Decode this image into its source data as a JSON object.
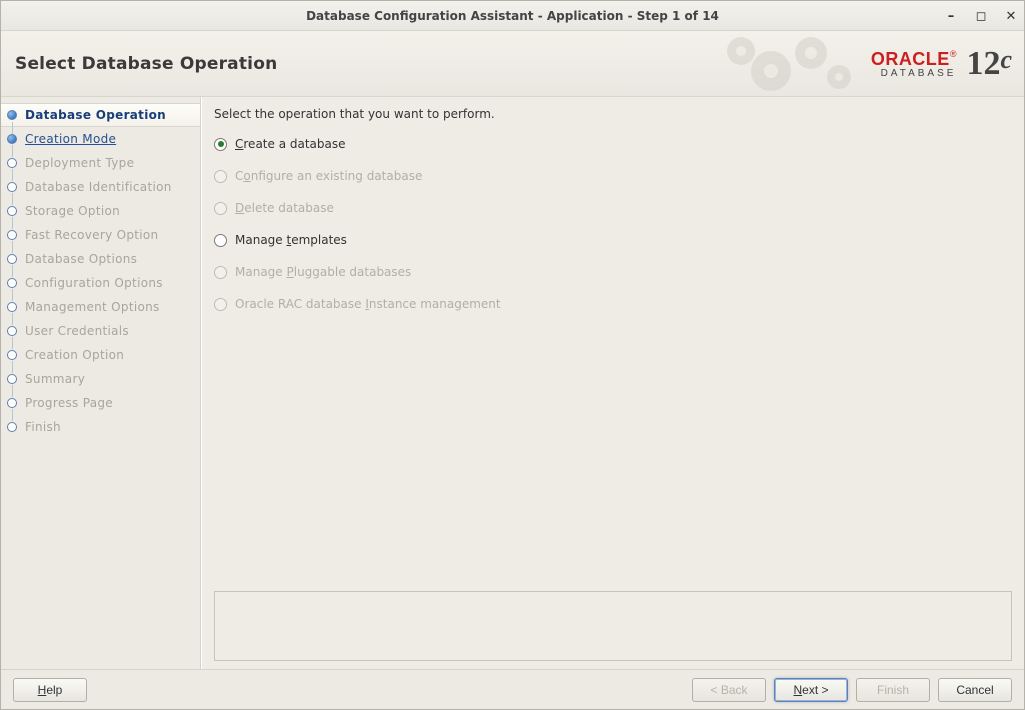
{
  "window": {
    "title": "Database Configuration Assistant - Application - Step 1 of 14"
  },
  "header": {
    "title": "Select Database Operation",
    "brand_word": "ORACLE",
    "brand_sub": "DATABASE",
    "brand_ver_num": "12",
    "brand_ver_suffix": "c"
  },
  "sidebar": {
    "steps": [
      {
        "label": "Database Operation",
        "state": "active"
      },
      {
        "label": "Creation Mode",
        "state": "link"
      },
      {
        "label": "Deployment Type",
        "state": "disabled"
      },
      {
        "label": "Database Identification",
        "state": "disabled"
      },
      {
        "label": "Storage Option",
        "state": "disabled"
      },
      {
        "label": "Fast Recovery Option",
        "state": "disabled"
      },
      {
        "label": "Database Options",
        "state": "disabled"
      },
      {
        "label": "Configuration Options",
        "state": "disabled"
      },
      {
        "label": "Management Options",
        "state": "disabled"
      },
      {
        "label": "User Credentials",
        "state": "disabled"
      },
      {
        "label": "Creation Option",
        "state": "disabled"
      },
      {
        "label": "Summary",
        "state": "disabled"
      },
      {
        "label": "Progress Page",
        "state": "disabled"
      },
      {
        "label": "Finish",
        "state": "disabled"
      }
    ]
  },
  "main": {
    "instruction": "Select the operation that you want to perform.",
    "options": [
      {
        "id": "create",
        "pre": "",
        "mn": "C",
        "post": "reate a database",
        "enabled": true,
        "checked": true
      },
      {
        "id": "configure",
        "pre": "C",
        "mn": "o",
        "post": "nfigure an existing database",
        "enabled": false,
        "checked": false
      },
      {
        "id": "delete",
        "pre": "",
        "mn": "D",
        "post": "elete database",
        "enabled": false,
        "checked": false
      },
      {
        "id": "templates",
        "pre": "Manage ",
        "mn": "t",
        "post": "emplates",
        "enabled": true,
        "checked": false
      },
      {
        "id": "pluggable",
        "pre": "Manage ",
        "mn": "P",
        "post": "luggable databases",
        "enabled": false,
        "checked": false
      },
      {
        "id": "rac",
        "pre": "Oracle RAC database ",
        "mn": "I",
        "post": "nstance management",
        "enabled": false,
        "checked": false
      }
    ]
  },
  "footer": {
    "help": "Help",
    "back": "< Back",
    "next": "Next >",
    "finish": "Finish",
    "cancel": "Cancel"
  }
}
